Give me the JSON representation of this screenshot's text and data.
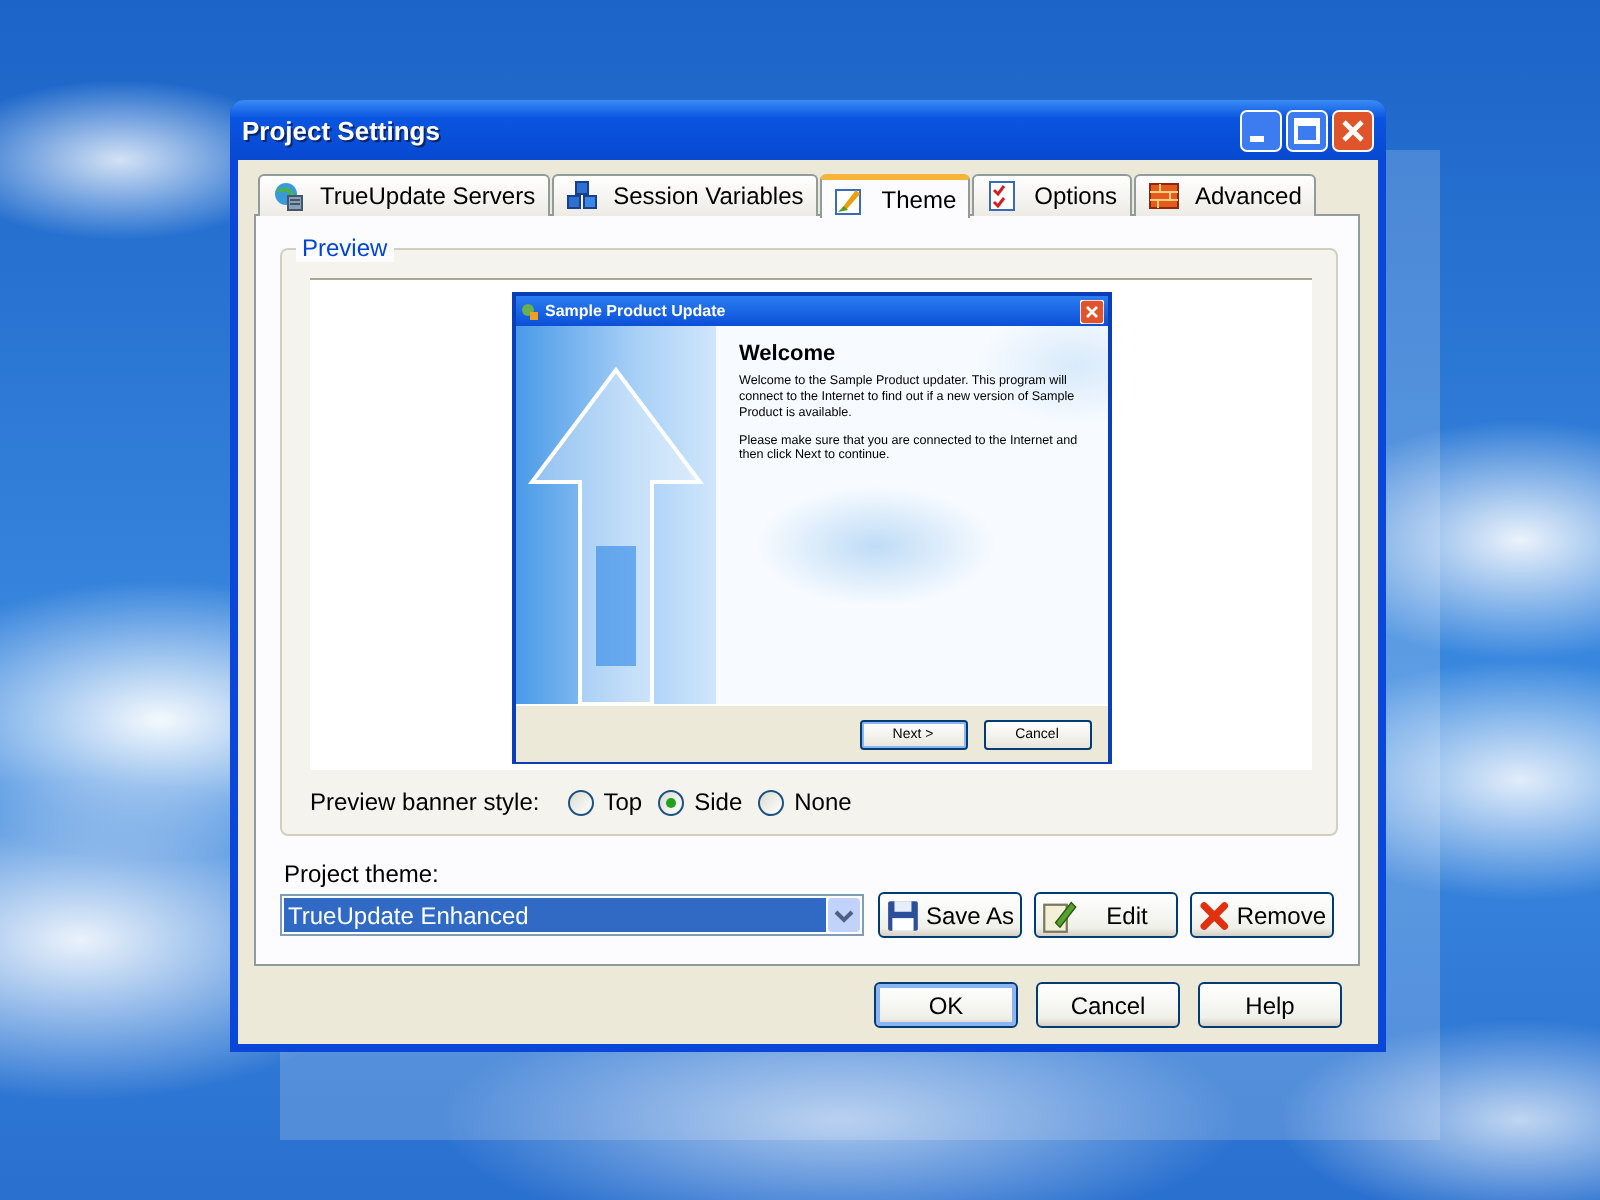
{
  "window": {
    "title": "Project Settings"
  },
  "tabs": [
    {
      "label": "TrueUpdate Servers",
      "selected": false
    },
    {
      "label": "Session Variables",
      "selected": false
    },
    {
      "label": "Theme",
      "selected": true
    },
    {
      "label": "Options",
      "selected": false
    },
    {
      "label": "Advanced",
      "selected": false
    }
  ],
  "preview": {
    "title": "Preview",
    "dialog": {
      "title": "Sample Product Update",
      "heading": "Welcome",
      "paragraphs": [
        "Welcome to the Sample Product updater. This program will connect to the Internet to find out if a new version of Sample Product is available.",
        "Please make sure that you are connected to the Internet and then click Next to continue."
      ],
      "buttons": [
        "Next >",
        "Cancel"
      ]
    }
  },
  "banner_style": {
    "label": "Preview banner style:",
    "options": [
      {
        "label": "Top",
        "selected": false
      },
      {
        "label": "Side",
        "selected": true
      },
      {
        "label": "None",
        "selected": false
      }
    ]
  },
  "theme": {
    "label": "Project theme:",
    "value": "TrueUpdate Enhanced"
  },
  "theme_buttons": [
    "Save As",
    "Edit",
    "Remove"
  ],
  "buttons": [
    "OK",
    "Cancel",
    "Help"
  ]
}
